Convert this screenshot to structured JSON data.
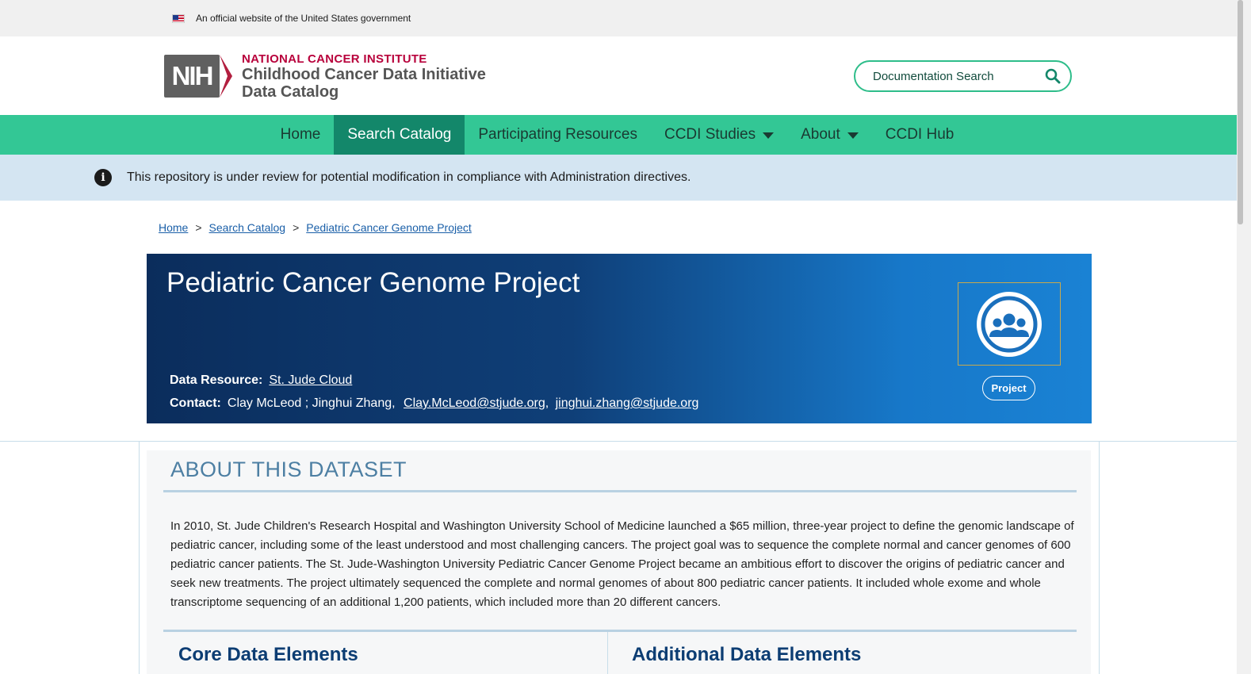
{
  "gov_banner": {
    "text": "An official website of the United States government",
    "flag_icon": "us-flag-icon"
  },
  "header": {
    "logo": {
      "mark": "NIH",
      "institute": "NATIONAL CANCER INSTITUTE",
      "line1": "Childhood Cancer Data Initiative",
      "line2": "Data Catalog"
    },
    "search": {
      "placeholder": "Documentation Search",
      "icon": "search-icon"
    }
  },
  "nav": {
    "items": [
      {
        "label": "Home",
        "active": false
      },
      {
        "label": "Search Catalog",
        "active": true
      },
      {
        "label": "Participating Resources",
        "active": false
      },
      {
        "label": "CCDI Studies",
        "active": false,
        "dropdown": true
      },
      {
        "label": "About",
        "active": false,
        "dropdown": true
      },
      {
        "label": "CCDI Hub",
        "active": false
      }
    ]
  },
  "alert": {
    "icon": "info-icon",
    "text": "This repository is under review for potential modification in compliance with Administration directives."
  },
  "breadcrumb": {
    "items": [
      "Home",
      "Search Catalog",
      "Pediatric Cancer Genome Project"
    ],
    "separator": ">"
  },
  "hero": {
    "title": "Pediatric Cancer Genome Project",
    "data_resource_label": "Data Resource:",
    "data_resource_value": "St. Jude Cloud",
    "contact_label": "Contact:",
    "contact_names": "Clay McLeod ; Jinghui Zhang,",
    "contact_email1": "Clay.McLeod@stjude.org",
    "contact_sep": ",",
    "contact_email2": "jinghui.zhang@stjude.org",
    "badge_icon": "group-people-icon",
    "badge_label": "Project"
  },
  "about": {
    "title": "ABOUT THIS DATASET",
    "body": "In 2010, St. Jude Children's Research Hospital and Washington University School of Medicine launched a $65 million, three-year project to define the genomic landscape of pediatric cancer, including some of the least understood and most challenging cancers. The project goal was to sequence the complete normal and cancer genomes of 600 pediatric cancer patients. The St. Jude-Washington University Pediatric Cancer Genome Project became an ambitious effort to discover the origins of pediatric cancer and seek new treatments. The project ultimately sequenced the complete and normal genomes of about 800 pediatric cancer patients. It included whole exome and whole transcriptome sequencing of an additional 1,200 patients, which included more than 20 different cancers.",
    "core_title": "Core Data Elements",
    "additional_title": "Additional Data Elements"
  },
  "colors": {
    "nav_bg": "#33c795",
    "nav_active": "#13876a",
    "alert_bg": "#d4e5f2",
    "hero_dark": "#0b2d5c",
    "hero_light": "#1a82d4",
    "nci_red": "#b8003b"
  }
}
